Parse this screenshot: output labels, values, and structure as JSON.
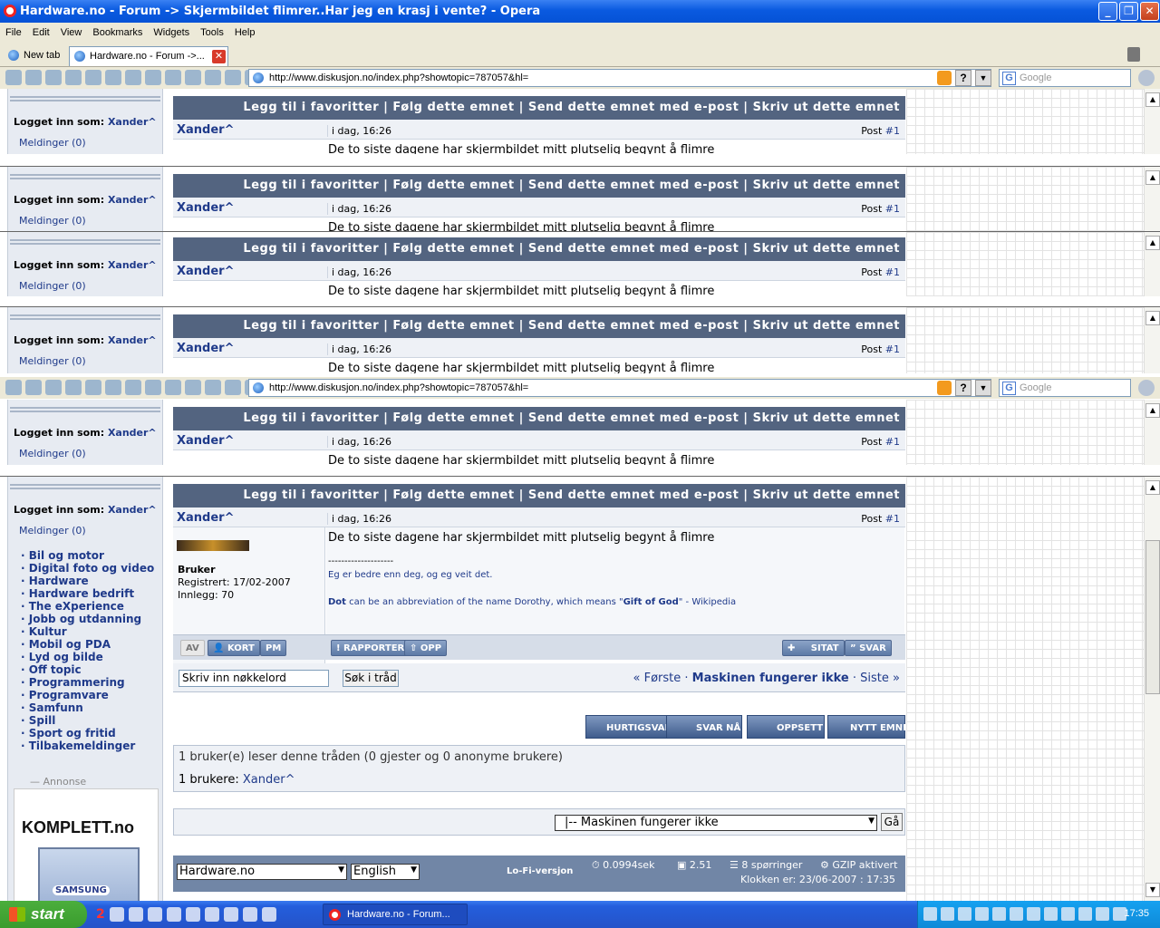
{
  "window": {
    "title": "Hardware.no - Forum -> Skjermbildet flimrer..Har jeg en krasj i vente? - Opera"
  },
  "menu": [
    "File",
    "Edit",
    "View",
    "Bookmarks",
    "Widgets",
    "Tools",
    "Help"
  ],
  "tabs": [
    {
      "label": "New tab"
    },
    {
      "label": "Hardware.no - Forum ->..."
    }
  ],
  "address": {
    "url": "http://www.diskusjon.no/index.php?showtopic=787057&hl=",
    "search_placeholder": "Google"
  },
  "sidebar": {
    "login_label": "Logget inn som:",
    "username": "Xander^",
    "messages": "Meldinger (0)",
    "categories": [
      "Bil og motor",
      "Digital foto og video",
      "Hardware",
      "Hardware bedrift",
      "The eXperience",
      "Jobb og utdanning",
      "Kultur",
      "Mobil og PDA",
      "Lyd og bilde",
      "Off topic",
      "Programmering",
      "Programvare",
      "Samfunn",
      "Spill",
      "Sport og fritid",
      "Tilbakemeldinger"
    ],
    "ad_label": "Annonse",
    "ad_brand": "KOMPLETT.no",
    "ad_product": "SAMSUNG"
  },
  "topic": {
    "actions": "Legg til i favoritter | Følg dette emnet | Send dette emnet med e-post | Skriv ut dette emnet",
    "author": "Xander^",
    "date": "i dag, 16:26",
    "post_label": "Post",
    "post_num": "#1",
    "text": "De to siste dagene har skjermbildet mitt plutselig begynt å flimre",
    "user_title": "Bruker",
    "registered": "Registrert: 17/02-2007",
    "posts": "Innlegg: 70",
    "sig_line": "--------------------",
    "sig1": "Eg er bedre enn deg, og eg veit det.",
    "sig2_a": "Dot",
    "sig2_b": " can be an abbreviation of the name Dorothy, which means \"",
    "sig2_c": "Gift of God",
    "sig2_d": "\" - Wikipedia"
  },
  "buttons": {
    "av": "AV",
    "kort": "KORT",
    "pm": "PM",
    "rapporter": "RAPPORTER",
    "opp": "OPP",
    "sitat": "SITAT",
    "svar": "SVAR",
    "hurtigsvar": "HURTIGSVAR",
    "svar_na": "SVAR NÅ",
    "oppsett": "OPPSETT",
    "nytt_emne": "NYTT EMNE"
  },
  "search": {
    "placeholder": "Skriv inn nøkkelord",
    "button": "Søk i tråd"
  },
  "pager": {
    "first": "« Første",
    "title": "Maskinen fungerer ikke",
    "last": "Siste »",
    "sep": "·"
  },
  "readers": {
    "heading": "1 bruker(e) leser denne tråden (0 gjester og 0 anonyme brukere)",
    "label": "1 brukere:",
    "user": "Xander^"
  },
  "jump": {
    "selected": "|-- Maskinen fungerer ikke",
    "go": "Gå"
  },
  "footer": {
    "site_select": "Hardware.no",
    "lang_select": "English",
    "lofi": "Lo-Fi-versjon",
    "time": "0.0994sek",
    "load": "2.51",
    "queries": "8 spørringer",
    "gzip": "GZIP aktivert",
    "clock": "Klokken er: 23/06-2007 : 17:35"
  },
  "taskbar": {
    "start": "start",
    "task": "Hardware.no - Forum...",
    "clock": "17:35",
    "ql_badge": "2"
  }
}
